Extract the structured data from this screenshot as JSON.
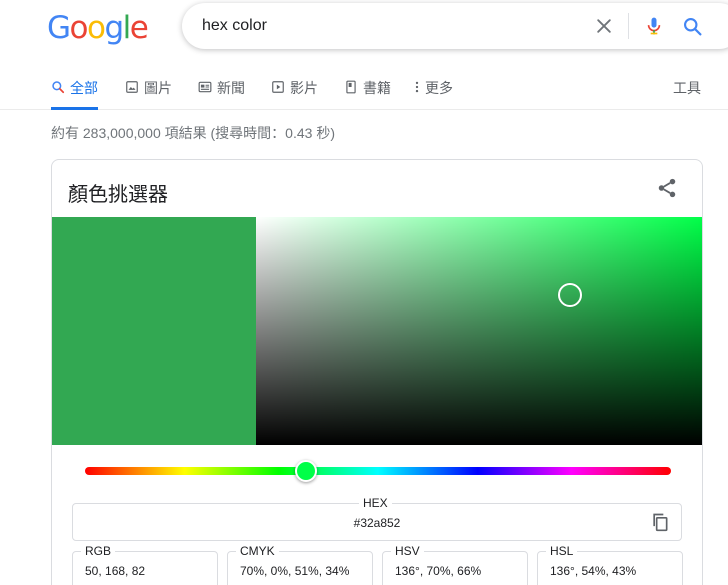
{
  "logo": {
    "letters": [
      "G",
      "o",
      "o",
      "g",
      "l",
      "e"
    ]
  },
  "search": {
    "query": "hex color"
  },
  "tabs": [
    {
      "label": "全部",
      "icon": "search-icon",
      "active": true
    },
    {
      "label": "圖片",
      "icon": "image-icon"
    },
    {
      "label": "新聞",
      "icon": "news-icon"
    },
    {
      "label": "影片",
      "icon": "video-icon"
    },
    {
      "label": "書籍",
      "icon": "book-icon"
    },
    {
      "label": "更多",
      "icon": "more-vert-icon"
    }
  ],
  "tools_label": "工具",
  "result_stats": "約有 283,000,000 項結果 (搜尋時間：0.43 秒)",
  "picker": {
    "title": "顏色挑選器",
    "selected_color": "#32a852",
    "hue_color": "#00ff48",
    "hue_degrees": 136,
    "saturation_percent": 70,
    "value_percent": 66,
    "hex": {
      "label": "HEX",
      "value": "#32a852"
    },
    "rgb": {
      "label": "RGB",
      "value": "50, 168, 82"
    },
    "cmyk": {
      "label": "CMYK",
      "value": "70%, 0%, 51%, 34%"
    },
    "hsv": {
      "label": "HSV",
      "value": "136°, 70%, 66%"
    },
    "hsl": {
      "label": "HSL",
      "value": "136°, 54%, 43%"
    }
  },
  "colors": {
    "accent": "#1a73e8",
    "google_blue": "#4285f4",
    "google_red": "#ea4335",
    "google_yellow": "#fbbc05",
    "google_green": "#34a853"
  }
}
